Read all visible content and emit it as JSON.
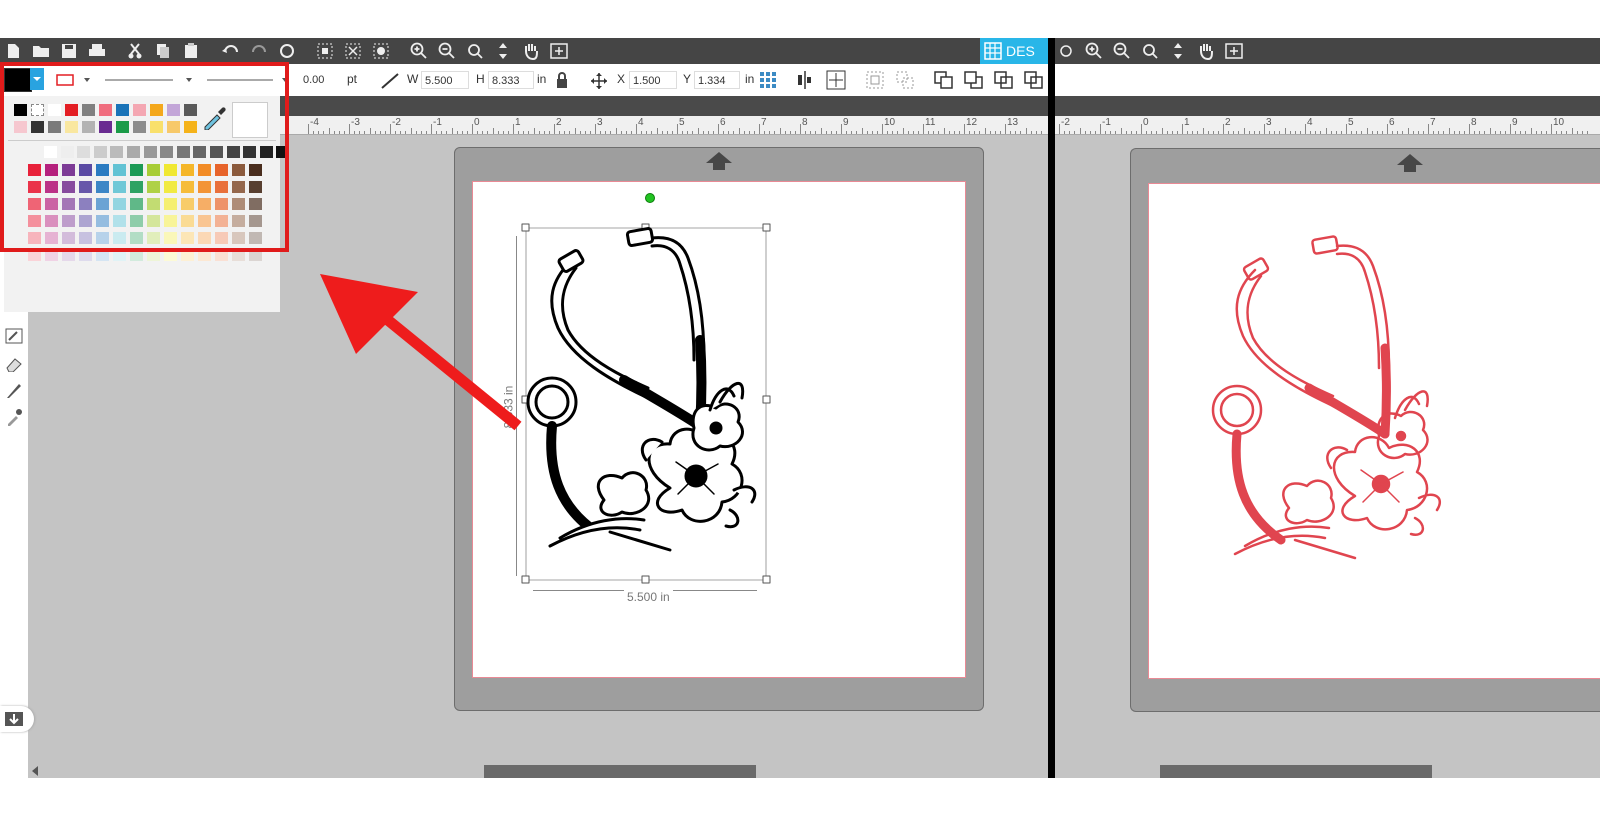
{
  "left_panel": {
    "tab_label": "DES",
    "line_width_value": "0.00",
    "line_width_unit": "pt",
    "width_label": "W",
    "width_value": "5.500",
    "height_label": "H",
    "height_value": "8.333",
    "size_unit": "in",
    "x_label": "X",
    "x_value": "1.500",
    "y_label": "Y",
    "y_value": "1.334",
    "position_unit": "in",
    "ruler_labels": [
      "-4",
      "-3",
      "-2",
      "-1",
      "0",
      "1",
      "2",
      "3",
      "4",
      "5",
      "6",
      "7",
      "8",
      "9",
      "10",
      "11",
      "12",
      "13"
    ],
    "dim_width_label": "5.500 in",
    "dim_height_label": "8.333 in",
    "stethoscope_color": "#000000"
  },
  "right_panel": {
    "ruler_labels": [
      "-2",
      "-1",
      "0",
      "1",
      "2",
      "3",
      "4",
      "5",
      "6",
      "7",
      "8",
      "9",
      "10"
    ],
    "stethoscope_color": "#e0454f"
  },
  "palette": {
    "selected_fill": "#000000",
    "highlight_color": "#e01b1b",
    "basic_row1": [
      "#000000",
      "transparent",
      "#ffffff",
      "#e31e24",
      "#808080",
      "#f06d7e",
      "#1a73b8",
      "#f4a7b2",
      "#f4a81c",
      "#c3a6d8",
      "#5a5a5a"
    ],
    "basic_row2": [
      "#f6c7cf",
      "#333333",
      "#7a7a7a",
      "#f9e7a0",
      "#b3b3b3",
      "#6a2c91",
      "#1b9b48",
      "#8c8c8c",
      "#f9e06b",
      "#f7c96a",
      "#f5b31b"
    ],
    "gray_row": [
      "#ffffff",
      "#eeeeee",
      "#dddddd",
      "#cccccc",
      "#bbbbbb",
      "#aaaaaa",
      "#999999",
      "#888888",
      "#777777",
      "#666666",
      "#555555",
      "#444444",
      "#333333",
      "#222222",
      "#111111"
    ],
    "hue_columns": [
      "#e8213a",
      "#b5207d",
      "#7d3b96",
      "#5a4aa3",
      "#2b7bc1",
      "#63c3d4",
      "#1c9a55",
      "#a8cd36",
      "#f0e832",
      "#f5b628",
      "#f28b25",
      "#e7642a",
      "#8b5a3c",
      "#4a2e1e"
    ]
  },
  "arrow_color": "#ee1c1c",
  "mat_icon": "up-arrow-icon"
}
